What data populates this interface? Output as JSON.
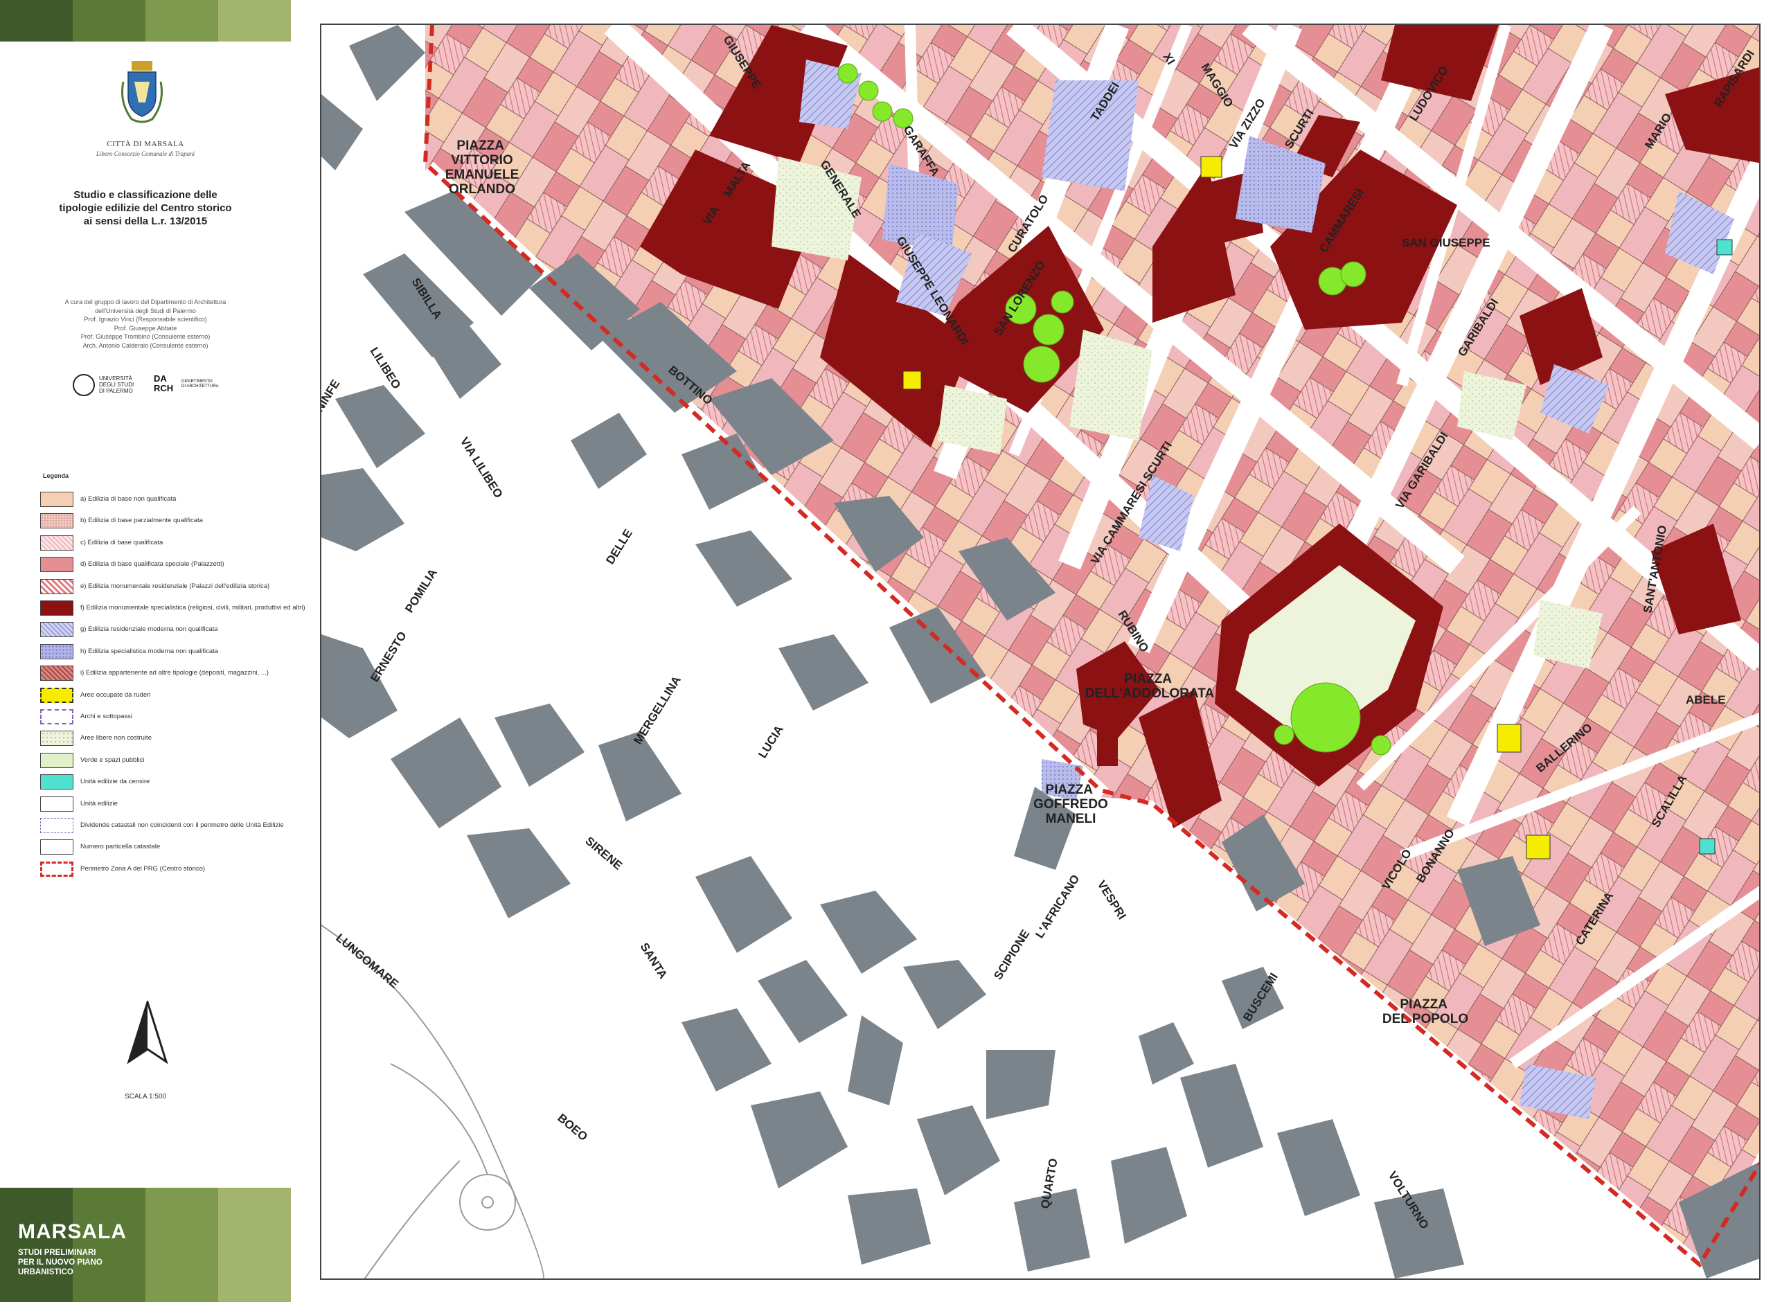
{
  "sidebar": {
    "colors": {
      "bar_dark": "#3e5a2b",
      "bar_mid": "#5b7a36",
      "bar_light": "#7e9a4f",
      "bar_pale": "#a3b46e"
    },
    "city_name": "CITTÀ DI MARSALA",
    "city_subtitle": "Libero Consorzio Comunale di Trapani",
    "study_title": "Studio e classificazione delle\ntipologie edilizie del Centro storico\nai sensi della L.r. 13/2015",
    "credits": "A cura del gruppo di lavoro del Dipartimento di Architettura\ndell'Università degli Studi di Palermo\nProf. Ignazio Vinci (Responsabile scientifico)\nProf. Giuseppe Abbate\nProf. Giuseppe Trombino (Consulente esterno)\nArch. Antonio Calderaio (Consulente esterno)",
    "logo_unipa_text": "UNIVERSITÀ\nDEGLI STUDI\nDI PALERMO",
    "logo_darch_mark": "DA\nRCH",
    "logo_darch_text": "DIPARTIMENTO\nDI ARCHITETTURA",
    "legend_title": "Legenda",
    "legend": [
      {
        "label": "a) Edilizia di base non qualificata",
        "color": "#f5cfb4",
        "pattern": "solid"
      },
      {
        "label": "b) Edilizia di base parzialmente qualificata",
        "color": "#f3c8bf",
        "pattern": "dense"
      },
      {
        "label": "c) Edilizia di base qualificata",
        "color": "#f0b8bd",
        "pattern": "hatch-light"
      },
      {
        "label": "d) Edilizia di base qualificata speciale (Palazzetti)",
        "color": "#e58f95",
        "pattern": "solid"
      },
      {
        "label": "e) Edilizia monumentale residenziale (Palazzi dell'edilizia storica)",
        "color": "#e17f87",
        "pattern": "stripes"
      },
      {
        "label": "f) Edilizia monumentale specialistica (religiosi, civili, militari, produttivi ed altri)",
        "color": "#8b1113",
        "pattern": "solid"
      },
      {
        "label": "g) Edilizia residenziale moderna non qualificata",
        "color": "#9da0dd",
        "pattern": "hatch"
      },
      {
        "label": "h) Edilizia specialistica moderna non qualificata",
        "color": "#b3b5e8",
        "pattern": "dots"
      },
      {
        "label": "i) Edilizia appartenente ad altre tipologie (depositi, magazzini, ...)",
        "color": "#a9463f",
        "pattern": "hatch-dark"
      },
      {
        "label": "Aree occupate da ruderi",
        "color": "#f5ec00",
        "pattern": "dashed"
      },
      {
        "label": "Archi e sottopassi",
        "color": "#ffffff",
        "pattern": "dashed-purple"
      },
      {
        "label": "Aree libere non costruite",
        "color": "#eef4dc",
        "pattern": "speckle"
      },
      {
        "label": "Verde e spazi pubblici",
        "color": "#e2f0c8",
        "pattern": "solid"
      },
      {
        "label": "Unità edilizie da censire",
        "color": "#4fe0cf",
        "pattern": "solid"
      },
      {
        "label": "Unità edilizie",
        "color": "#ffffff",
        "pattern": "solid"
      },
      {
        "label": "Dividende catastali non coincidenti con il perimetro delle Unità Edilizie",
        "color": "#ffffff",
        "pattern": "dashline"
      },
      {
        "label": "Numero particella catastale",
        "color": "#ffffff",
        "pattern": "solid"
      },
      {
        "label": "Perimetro Zona A del PRG (Centro storico)",
        "color": "#ffffff",
        "pattern": "red-dashed"
      }
    ],
    "scale_label": "SCALA 1:500",
    "brand_name": "MARSALA",
    "brand_subtitle": "STUDI PRELIMINARI\nPER IL NUOVO PIANO\nURBANISTICO"
  },
  "map": {
    "colors": {
      "modern_block": "#7b838b",
      "monumental": "#8b1113",
      "base": "#f5cfb4",
      "palazzetti": "#e58f95",
      "qualificata": "#f0b8bd",
      "modern_res": "#9da0dd",
      "modern_spec": "#b3b5e8",
      "tree": "#86e82a",
      "ruderi": "#f5ec00",
      "censire": "#4fe0cf",
      "perimeter": "#d42a22"
    },
    "street_labels": [
      "GIUSEPPE",
      "GARAFFA",
      "VIA",
      "MALTA",
      "GENERALE",
      "GIUSEPPE LEONARDI",
      "SAN LORENZO",
      "CURATOLO",
      "TADDEI",
      "XI",
      "MAGGIO",
      "VIA ZIZZO",
      "LUDOVICO",
      "SCURTI",
      "CAMMARESI",
      "SAN GIUSEPPE",
      "RAPISARDI",
      "MARIO",
      "SIBILLA",
      "LILIBEO",
      "VIA LILIBEO",
      "BOTTINO",
      "NINFE",
      "POMILIA",
      "DELLE",
      "ERNESTO",
      "MERGELLINA",
      "LUCIA",
      "SIRENE",
      "SANTA",
      "BOEO",
      "LUNGOMARE",
      "SCIPIONE",
      "L'AFRICANO",
      "QUARTO",
      "VESPRI",
      "BUSCEMI",
      "VOLTURNO",
      "RUBINO",
      "VIA CAMMARESI SCURTI",
      "VIA GARIBALDI",
      "GARIBALDI",
      "SANT'ANTONIO",
      "ABELE",
      "BALLERINO",
      "SCALILLA",
      "CATERINA",
      "VICOLO",
      "BONANNO"
    ],
    "piazza_labels": [
      "PIAZZA\nVITTORIO\nEMANUELE\nORLANDO",
      "PIAZZA\nDELL'ADDOLORATA",
      "PIAZZA\nGOFFREDO\nMANELI",
      "PIAZZA\nDEL POPOLO"
    ]
  }
}
